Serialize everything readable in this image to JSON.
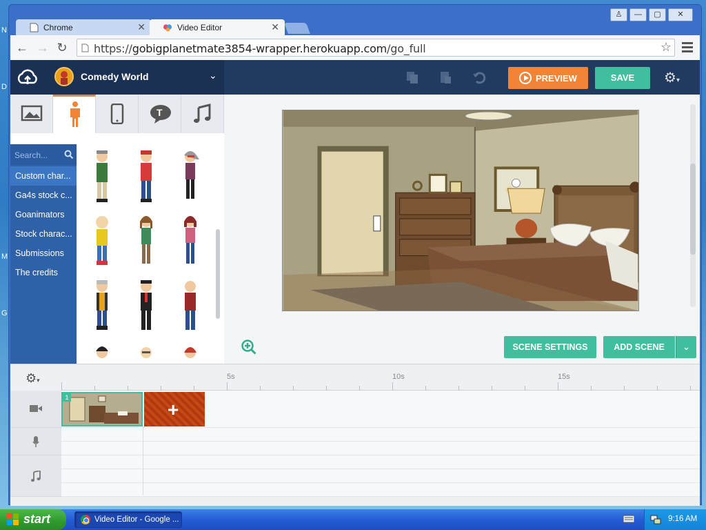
{
  "browser": {
    "tabs": [
      {
        "label": "Chrome"
      },
      {
        "label": "Video Editor"
      }
    ],
    "url_scheme": "https://",
    "url_host": "gobigplanetmate3854-wrapper.herokuapp.com",
    "url_path": "/go_full"
  },
  "app": {
    "project_title": "Comedy World",
    "preview_label": "PREVIEW",
    "save_label": "SAVE",
    "colors": {
      "topbar": "#203a60",
      "preview": "#f08537",
      "save": "#3fbf9e",
      "category_panel": "#2e61a8"
    }
  },
  "asset_panel": {
    "tabs": [
      "image-icon",
      "character-icon",
      "phone-icon",
      "text-bubble-icon",
      "music-icon"
    ],
    "active_tab": 1,
    "search_placeholder": "Search...",
    "categories": [
      {
        "label": "Custom char..."
      },
      {
        "label": "Ga4s stock c..."
      },
      {
        "label": "Goanimators"
      },
      {
        "label": "Stock charac..."
      },
      {
        "label": "Submissions"
      },
      {
        "label": "The credits"
      }
    ]
  },
  "stage": {
    "scene_settings_label": "SCENE SETTINGS",
    "add_scene_label": "ADD SCENE"
  },
  "timeline": {
    "ticks": [
      "5s",
      "10s",
      "15s"
    ],
    "scene_number": "1",
    "add_symbol": "+"
  },
  "taskbar": {
    "start_label": "start",
    "task_label": "Video Editor - Google ...",
    "clock": "9:16 AM"
  },
  "desktop": {
    "letters": [
      "N",
      "D",
      "M",
      "G"
    ]
  }
}
